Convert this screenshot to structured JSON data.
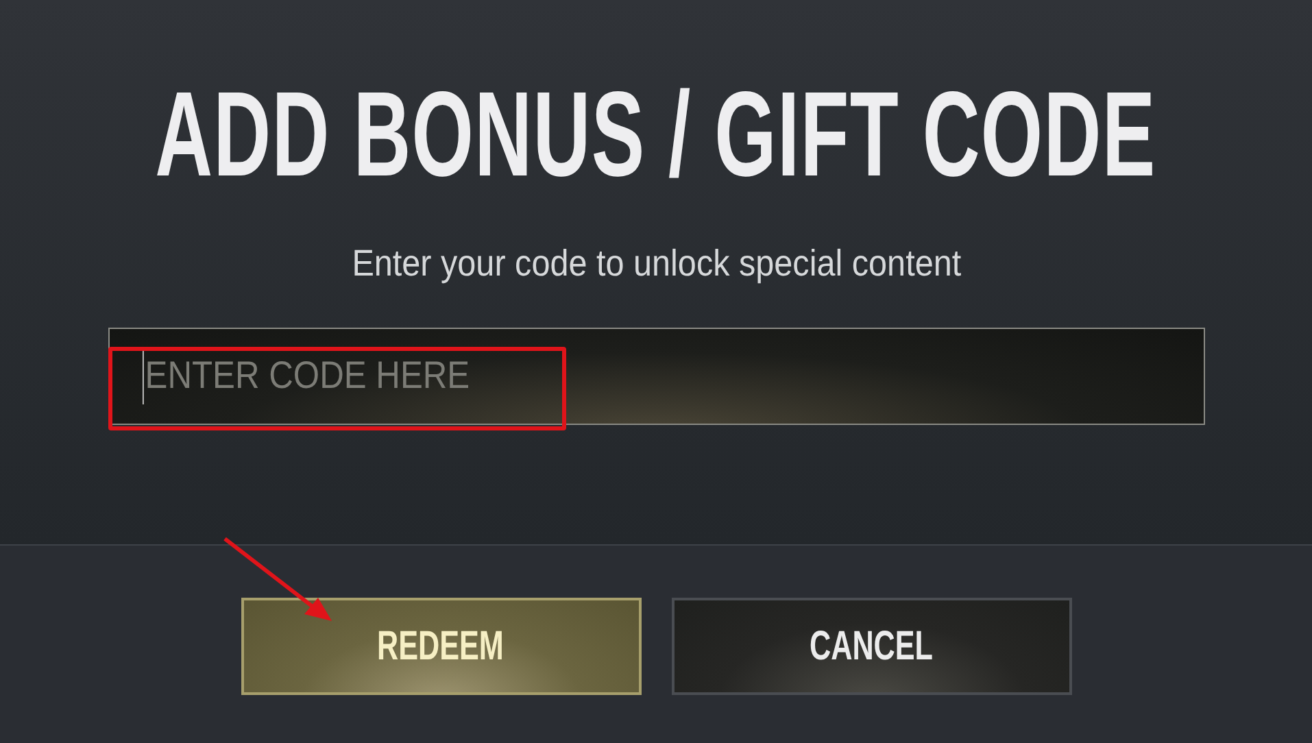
{
  "title": "ADD BONUS / GIFT CODE",
  "subtitle": "Enter your code to unlock special content",
  "code_field": {
    "placeholder": "ENTER CODE HERE"
  },
  "buttons": [
    {
      "label": "REDEEM",
      "kind": "primary"
    },
    {
      "label": "CANCEL",
      "kind": "secondary"
    }
  ]
}
